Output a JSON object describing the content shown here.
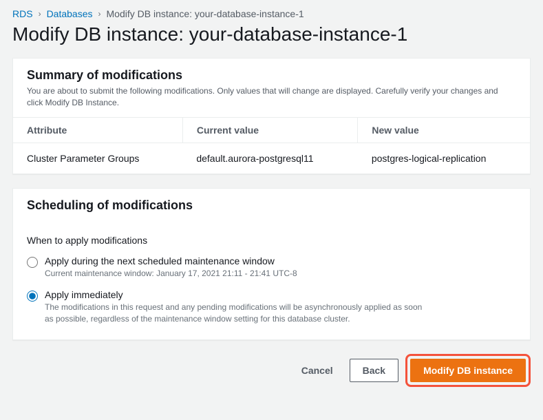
{
  "breadcrumb": {
    "rds": "RDS",
    "databases": "Databases",
    "current": "Modify DB instance: your-database-instance-1"
  },
  "page_title": "Modify DB instance: your-database-instance-1",
  "summary": {
    "heading": "Summary of modifications",
    "description": "You are about to submit the following modifications. Only values that will change are displayed. Carefully verify your changes and click Modify DB Instance.",
    "columns": {
      "attr": "Attribute",
      "current": "Current value",
      "new": "New value"
    },
    "row": {
      "attr": "Cluster Parameter Groups",
      "current": "default.aurora-postgresql11",
      "new": "postgres-logical-replication"
    }
  },
  "scheduling": {
    "heading": "Scheduling of modifications",
    "when_label": "When to apply modifications",
    "option1": {
      "label": "Apply during the next scheduled maintenance window",
      "hint": "Current maintenance window: January 17, 2021 21:11 - 21:41 UTC-8"
    },
    "option2": {
      "label": "Apply immediately",
      "hint": "The modifications in this request and any pending modifications will be asynchronously applied as soon as possible, regardless of the maintenance window setting for this database cluster."
    }
  },
  "buttons": {
    "cancel": "Cancel",
    "back": "Back",
    "modify": "Modify DB instance"
  }
}
